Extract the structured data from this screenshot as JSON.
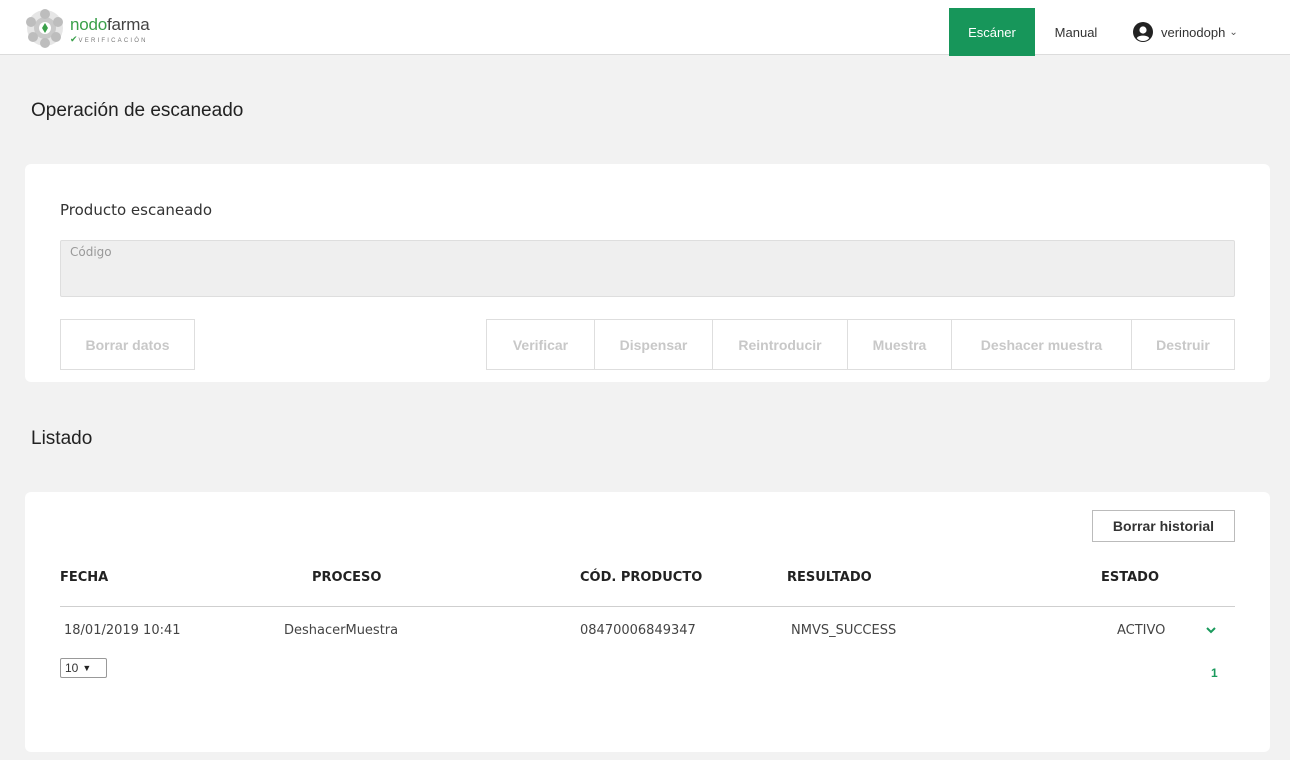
{
  "header": {
    "logo_name_prefix": "nodo",
    "logo_name_suffix": "farma",
    "logo_sub": "VERIFICACIÓN",
    "nav_scanner": "Escáner",
    "nav_manual": "Manual",
    "username": "verinodoph"
  },
  "colors": {
    "accent": "#17965a",
    "page_bg": "#f2f2f2",
    "card_bg": "#ffffff"
  },
  "scan": {
    "title": "Operación de escaneado",
    "product_label": "Producto escaneado",
    "code_placeholder": "Código",
    "clear_button": "Borrar datos",
    "actions": [
      "Verificar",
      "Dispensar",
      "Reintroducir",
      "Muestra",
      "Deshacer muestra",
      "Destruir"
    ]
  },
  "list": {
    "title": "Listado",
    "clear_history_button": "Borrar historial",
    "columns": {
      "fecha": "FECHA",
      "proceso": "PROCESO",
      "cod_producto": "CÓD. PRODUCTO",
      "resultado": "RESULTADO",
      "estado": "ESTADO"
    },
    "rows": [
      {
        "fecha": "18/01/2019 10:41",
        "proceso": "DeshacerMuestra",
        "cod_producto": "08470006849347",
        "resultado": "NMVS_SUCCESS",
        "estado": "ACTIVO"
      }
    ],
    "page_size": "10",
    "current_page": "1"
  }
}
